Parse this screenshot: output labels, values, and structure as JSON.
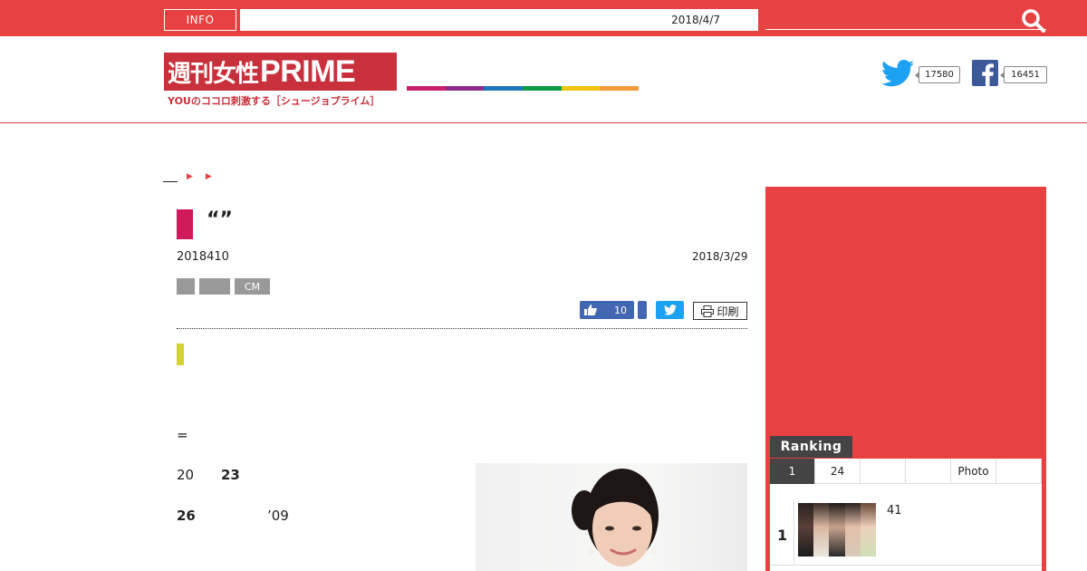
{
  "topbar": {
    "info_label": "INFO",
    "ticker_date": "2018/4/7"
  },
  "header": {
    "logo_jp": "週刊女性",
    "logo_en": "PRIME",
    "logo_tagline": "YOUのココロ刺激する［シュージョプライム］",
    "brand_colors": [
      "#c8206a",
      "#8e2b8a",
      "#1d75bc",
      "#0f9a48",
      "#f1c40f",
      "#f39a3a"
    ],
    "twitter_count": "17580",
    "facebook_count": "16451"
  },
  "article": {
    "title": "“”",
    "issue": "2018410",
    "date": "2018/3/29",
    "tags": [
      "",
      "",
      "CM"
    ],
    "like_count": "10",
    "print_label": "印刷",
    "body": {
      "eq": "=",
      "line1a": "20",
      "line1b": "23",
      "line2a": "26",
      "line2b": "’09"
    }
  },
  "sidebar": {
    "ranking_label": "Ranking",
    "tabs": [
      "1",
      "24",
      "",
      "",
      "Photo",
      ""
    ],
    "items": [
      {
        "rank": "1",
        "text": "41"
      }
    ]
  }
}
